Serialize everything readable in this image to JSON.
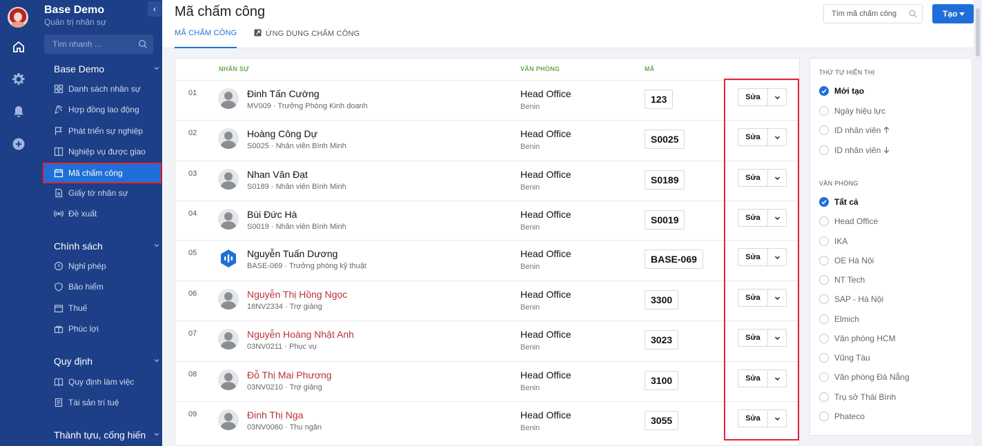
{
  "app": {
    "brand_name": "Base Demo",
    "brand_sub": "Quản trị nhân sự"
  },
  "sidebar": {
    "search_placeholder": "Tìm nhanh ...",
    "sections": [
      {
        "label": "Base Demo"
      },
      {
        "label": "Chính sách"
      },
      {
        "label": "Quy định"
      },
      {
        "label": "Thành tựu, cống hiến"
      }
    ],
    "items": [
      {
        "label": "Danh sách nhân sự",
        "icon": "grid-icon"
      },
      {
        "label": "Hợp đồng lao động",
        "icon": "contract-icon"
      },
      {
        "label": "Phát triển sự nghiệp",
        "icon": "flag-icon"
      },
      {
        "label": "Nghiệp vụ được giao",
        "icon": "columns-icon"
      },
      {
        "label": "Mã chấm công",
        "icon": "calendar-icon",
        "active": true
      },
      {
        "label": "Giấy tờ nhân sự",
        "icon": "document-icon"
      },
      {
        "label": "Đề xuất",
        "icon": "broadcast-icon"
      },
      {
        "label": "Nghỉ phép",
        "icon": "clock-icon"
      },
      {
        "label": "Bảo hiểm",
        "icon": "shield-icon"
      },
      {
        "label": "Thuế",
        "icon": "box-icon"
      },
      {
        "label": "Phúc lợi",
        "icon": "gift-icon"
      },
      {
        "label": "Quy định làm việc",
        "icon": "book-icon"
      },
      {
        "label": "Tài sản trí tuệ",
        "icon": "file-icon"
      }
    ]
  },
  "header": {
    "title": "Mã chấm công",
    "tabs": [
      {
        "label": "MÃ CHẤM CÔNG",
        "active": true
      },
      {
        "label": "ỨNG DỤNG CHẤM CÔNG",
        "active": false
      }
    ],
    "search_placeholder": "Tìm mã chấm công",
    "create_label": "Tạo"
  },
  "table": {
    "columns": {
      "person": "NHÂN SỰ",
      "office": "VĂN PHÒNG",
      "code": "MÃ"
    },
    "edit_label": "Sửa",
    "rows": [
      {
        "idx": "01",
        "name": "Đinh Tấn Cường",
        "sub": "MV009 · Trưởng Phòng Kinh doanh",
        "office": "Head Office",
        "office_sub": "Benin",
        "code": "123",
        "red": false
      },
      {
        "idx": "02",
        "name": "Hoàng Công Dự",
        "sub": "S0025 · Nhân viên Bình Minh",
        "office": "Head Office",
        "office_sub": "Benin",
        "code": "S0025",
        "red": false
      },
      {
        "idx": "03",
        "name": "Nhan Văn Đạt",
        "sub": "S0189 · Nhân viên Bình Minh",
        "office": "Head Office",
        "office_sub": "Benin",
        "code": "S0189",
        "red": false
      },
      {
        "idx": "04",
        "name": "Bùi Đức Hà",
        "sub": "S0019 · Nhân viên Bình Minh",
        "office": "Head Office",
        "office_sub": "Benin",
        "code": "S0019",
        "red": false
      },
      {
        "idx": "05",
        "name": "Nguyễn Tuấn Dương",
        "sub": "BASE-069 · Trưởng phòng kỹ thuật",
        "office": "Head Office",
        "office_sub": "Benin",
        "code": "BASE-069",
        "red": false,
        "logo": true
      },
      {
        "idx": "06",
        "name": "Nguyễn Thị Hồng Ngọc",
        "sub": "18NV2334 · Trợ giảng",
        "office": "Head Office",
        "office_sub": "Benin",
        "code": "3300",
        "red": true
      },
      {
        "idx": "07",
        "name": "Nguyễn Hoàng Nhật Anh",
        "sub": "03NV0211 · Phục vụ",
        "office": "Head Office",
        "office_sub": "Benin",
        "code": "3023",
        "red": true
      },
      {
        "idx": "08",
        "name": "Đỗ Thị Mai Phương",
        "sub": "03NV0210 · Trợ giảng",
        "office": "Head Office",
        "office_sub": "Benin",
        "code": "3100",
        "red": true
      },
      {
        "idx": "09",
        "name": "Đinh Thị Nga",
        "sub": "03NV0060 · Thu ngân",
        "office": "Head Office",
        "office_sub": "Benin",
        "code": "3055",
        "red": true
      }
    ]
  },
  "filters": {
    "order_heading": "THỨ TỰ HIỂN THỊ",
    "order_options": [
      {
        "label": "Mới tạo",
        "checked": true,
        "arrow": ""
      },
      {
        "label": "Ngày hiệu lực",
        "checked": false,
        "arrow": ""
      },
      {
        "label": "ID nhân viên",
        "checked": false,
        "arrow": "up"
      },
      {
        "label": "ID nhân viên",
        "checked": false,
        "arrow": "down"
      }
    ],
    "office_heading": "VĂN PHÒNG",
    "office_options": [
      {
        "label": "Tất cả",
        "checked": true
      },
      {
        "label": "Head Office",
        "checked": false
      },
      {
        "label": "IKA",
        "checked": false
      },
      {
        "label": "OE Hà Nội",
        "checked": false
      },
      {
        "label": "NT Tech",
        "checked": false
      },
      {
        "label": "SAP - Hà Nội",
        "checked": false
      },
      {
        "label": "Elmich",
        "checked": false
      },
      {
        "label": "Văn phòng HCM",
        "checked": false
      },
      {
        "label": "Vũng Tàu",
        "checked": false
      },
      {
        "label": "Văn phòng Đà Nẵng",
        "checked": false
      },
      {
        "label": "Trụ sở Thái Bình",
        "checked": false
      },
      {
        "label": "Phateco",
        "checked": false
      }
    ]
  },
  "colors": {
    "sidebar_bg": "#1c3f87",
    "accent": "#1f6fd8",
    "column_head": "#6aa84f",
    "name_red": "#b8323a",
    "highlight": "#e0253a"
  }
}
